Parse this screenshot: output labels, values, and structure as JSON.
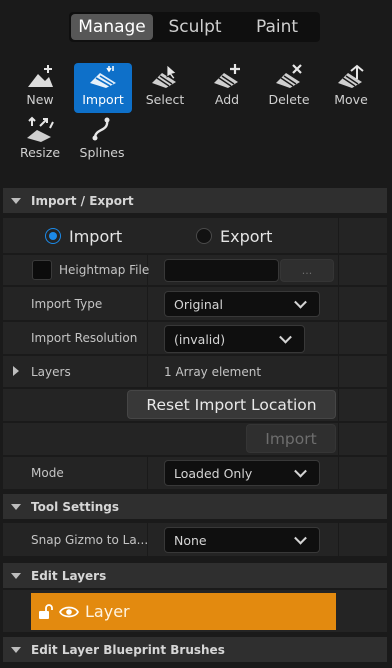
{
  "mode_tabs": [
    "Manage",
    "Sculpt",
    "Paint"
  ],
  "tools": [
    {
      "label": "New",
      "icon": "new-icon",
      "active": false
    },
    {
      "label": "Import",
      "icon": "import-icon",
      "active": true
    },
    {
      "label": "Select",
      "icon": "select-icon",
      "active": false
    },
    {
      "label": "Add",
      "icon": "add-icon",
      "active": false
    },
    {
      "label": "Delete",
      "icon": "delete-icon",
      "active": false
    },
    {
      "label": "Move",
      "icon": "move-icon",
      "active": false
    },
    {
      "label": "Resize",
      "icon": "resize-icon",
      "active": false
    },
    {
      "label": "Splines",
      "icon": "splines-icon",
      "active": false
    }
  ],
  "import_export": {
    "header": "Import / Export",
    "radio_import": "Import",
    "radio_export": "Export",
    "selected": "Import",
    "heightmap_label": "Heightmap File",
    "heightmap_value": "",
    "browse_label": "...",
    "import_type_label": "Import Type",
    "import_type_value": "Original",
    "import_resolution_label": "Import Resolution",
    "import_resolution_value": "(invalid)",
    "layers_label": "Layers",
    "layers_value": "1 Array element",
    "reset_button": "Reset Import Location",
    "import_button": "Import",
    "mode_label": "Mode",
    "mode_value": "Loaded Only"
  },
  "tool_settings": {
    "header": "Tool Settings",
    "snap_label": "Snap Gizmo to La...",
    "snap_value": "None"
  },
  "edit_layers": {
    "header": "Edit Layers",
    "layer_name": "Layer"
  },
  "blueprint_brushes": {
    "header": "Edit Layer Blueprint Brushes"
  },
  "colors": {
    "accent_blue": "#0e70c9",
    "layer_orange": "#e38a0f",
    "panel_bg": "#242424",
    "header_bg": "#2f2f2f"
  }
}
